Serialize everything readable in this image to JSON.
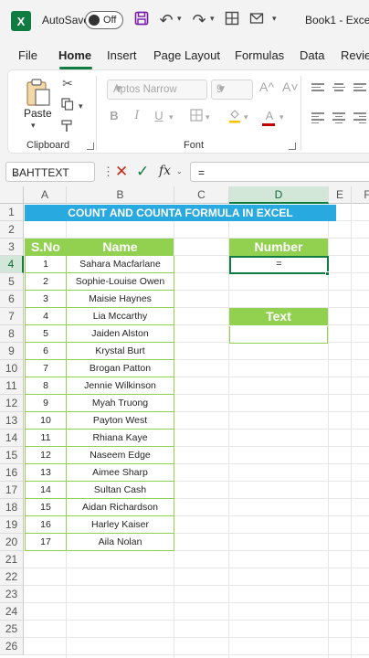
{
  "titlebar": {
    "logo_letter": "X",
    "autosave_label": "AutoSave",
    "autosave_state": "Off",
    "book_title": "Book1 - Exce"
  },
  "menu": {
    "tabs": [
      "File",
      "Home",
      "Insert",
      "Page Layout",
      "Formulas",
      "Data",
      "Revie"
    ],
    "active": "Home"
  },
  "ribbon": {
    "paste_label": "Paste",
    "clipboard_label": "Clipboard",
    "font_label": "Font",
    "font_name": "Aptos Narrow",
    "font_size": "9",
    "bold": "B",
    "italic": "I",
    "underline": "U",
    "grow_font": "A^",
    "shrink_font": "A˅",
    "font_color_letter": "A"
  },
  "formula_bar": {
    "name_box": "BAHTTEXT",
    "fx": "fx",
    "content": "="
  },
  "grid": {
    "columns": [
      "A",
      "B",
      "C",
      "D",
      "E",
      "F"
    ],
    "selected_column": "D",
    "rows": [
      "1",
      "2",
      "3",
      "4",
      "5",
      "6",
      "7",
      "8",
      "9",
      "10",
      "11",
      "12",
      "13",
      "14",
      "15",
      "16",
      "17",
      "18",
      "19",
      "20",
      "21",
      "22",
      "23",
      "24",
      "25",
      "26"
    ],
    "selected_row": "4"
  },
  "sheet": {
    "banner": "COUNT AND COUNTA FORMULA IN EXCEL",
    "table_headers": {
      "sno": "S.No",
      "name": "Name"
    },
    "table_rows": [
      {
        "sno": "1",
        "name": "Sahara Macfarlane"
      },
      {
        "sno": "2",
        "name": "Sophie-Louise Owen"
      },
      {
        "sno": "3",
        "name": "Maisie Haynes"
      },
      {
        "sno": "4",
        "name": "Lia Mccarthy"
      },
      {
        "sno": "5",
        "name": "Jaiden Alston"
      },
      {
        "sno": "6",
        "name": "Krystal Burt"
      },
      {
        "sno": "7",
        "name": "Brogan Patton"
      },
      {
        "sno": "8",
        "name": "Jennie Wilkinson"
      },
      {
        "sno": "9",
        "name": "Myah Truong"
      },
      {
        "sno": "10",
        "name": "Payton West"
      },
      {
        "sno": "11",
        "name": "Rhiana Kaye"
      },
      {
        "sno": "12",
        "name": "Naseem Edge"
      },
      {
        "sno": "13",
        "name": "Aimee Sharp"
      },
      {
        "sno": "14",
        "name": "Sultan Cash"
      },
      {
        "sno": "15",
        "name": "Aidan Richardson"
      },
      {
        "sno": "16",
        "name": "Harley Kaiser"
      },
      {
        "sno": "17",
        "name": "Aila Nolan"
      }
    ],
    "number_header": "Number",
    "number_cell_value": "=",
    "text_header": "Text",
    "text_cell_value": ""
  },
  "colors": {
    "excel_green": "#107c41",
    "banner_blue": "#28a9df",
    "header_green": "#92d050"
  }
}
